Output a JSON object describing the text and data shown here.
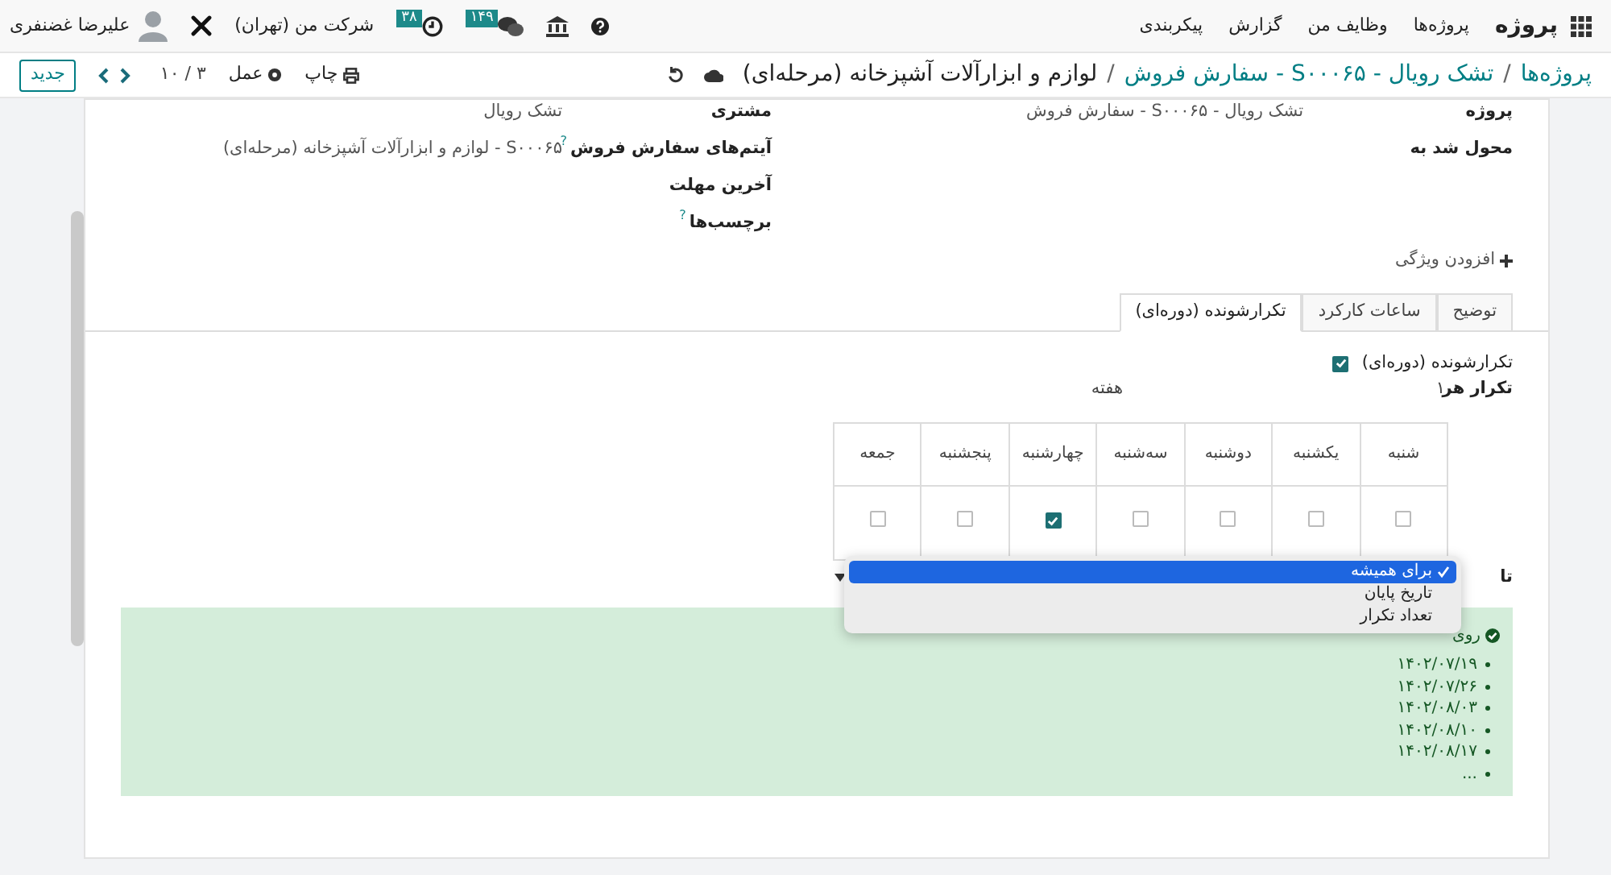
{
  "navbar": {
    "app": "پروژه",
    "menu": [
      "پروژه‌ها",
      "وظایف من",
      "گزارش",
      "پیکربندی"
    ],
    "messages_count": "۱۴۹",
    "activities_count": "۳۸",
    "company": "شرکت من (تهران)",
    "user": "علیرضا غضنفری"
  },
  "control_panel": {
    "breadcrumbs": [
      {
        "label": "پروژه‌ها",
        "current": false
      },
      {
        "label": "تشک رویال - S۰۰۰۶۵ - سفارش فروش",
        "current": false
      },
      {
        "label": "لوازم و ابزارآلات آشپزخانه (مرحله‌ای)",
        "current": true
      }
    ],
    "separator": "/",
    "print": "چاپ",
    "action": "عمل",
    "pager": "۳ / ۱۰",
    "new": "جدید"
  },
  "form": {
    "fields_right": [
      {
        "label": "پروژه",
        "value": "تشک رویال - S۰۰۰۶۵ - سفارش فروش"
      },
      {
        "label": "محول شد به"
      }
    ],
    "fields_left": [
      {
        "label": "مشتری",
        "value": "تشک رویال"
      },
      {
        "label": "آیتم‌های سفارش فروش",
        "help": "?",
        "value": "S۰۰۰۶۵ - لوازم و ابزارآلات آشپزخانه (مرحله‌ای)"
      },
      {
        "label": "آخرین مهلت"
      },
      {
        "label": "برچسب‌ها",
        "help": "?"
      }
    ],
    "add_property": "افزودن ویژگی"
  },
  "tabs": [
    {
      "label": "توضیح",
      "selected": false
    },
    {
      "label": "ساعات کارکرد",
      "selected": false
    },
    {
      "label": "تکرارشونده (دوره‌ای)",
      "selected": true
    }
  ],
  "recurrence": {
    "label": "تکرارشونده (دوره‌ای)",
    "checked": true,
    "repeat_label": "تکرار هر",
    "repeat_value": "۱",
    "repeat_unit": "هفته",
    "days": [
      {
        "label": "شنبه",
        "checked": false
      },
      {
        "label": "یکشنبه",
        "checked": false
      },
      {
        "label": "دوشنبه",
        "checked": false
      },
      {
        "label": "سه‌شنبه",
        "checked": false
      },
      {
        "label": "چهارشنبه",
        "checked": true
      },
      {
        "label": "پنجشنبه",
        "checked": false
      },
      {
        "label": "جمعه",
        "checked": false
      }
    ],
    "until_label": "تا",
    "until_options": [
      {
        "label": "برای همیشه",
        "selected": true
      },
      {
        "label": "تاریخ پایان",
        "selected": false
      },
      {
        "label": "تعداد تکرار",
        "selected": false
      }
    ]
  },
  "alert": {
    "text": "روی",
    "dates": [
      "۱۴۰۲/۰۷/۱۹",
      "۱۴۰۲/۰۷/۲۶",
      "۱۴۰۲/۰۸/۰۳",
      "۱۴۰۲/۰۸/۱۰",
      "۱۴۰۲/۰۸/۱۷",
      "..."
    ]
  }
}
